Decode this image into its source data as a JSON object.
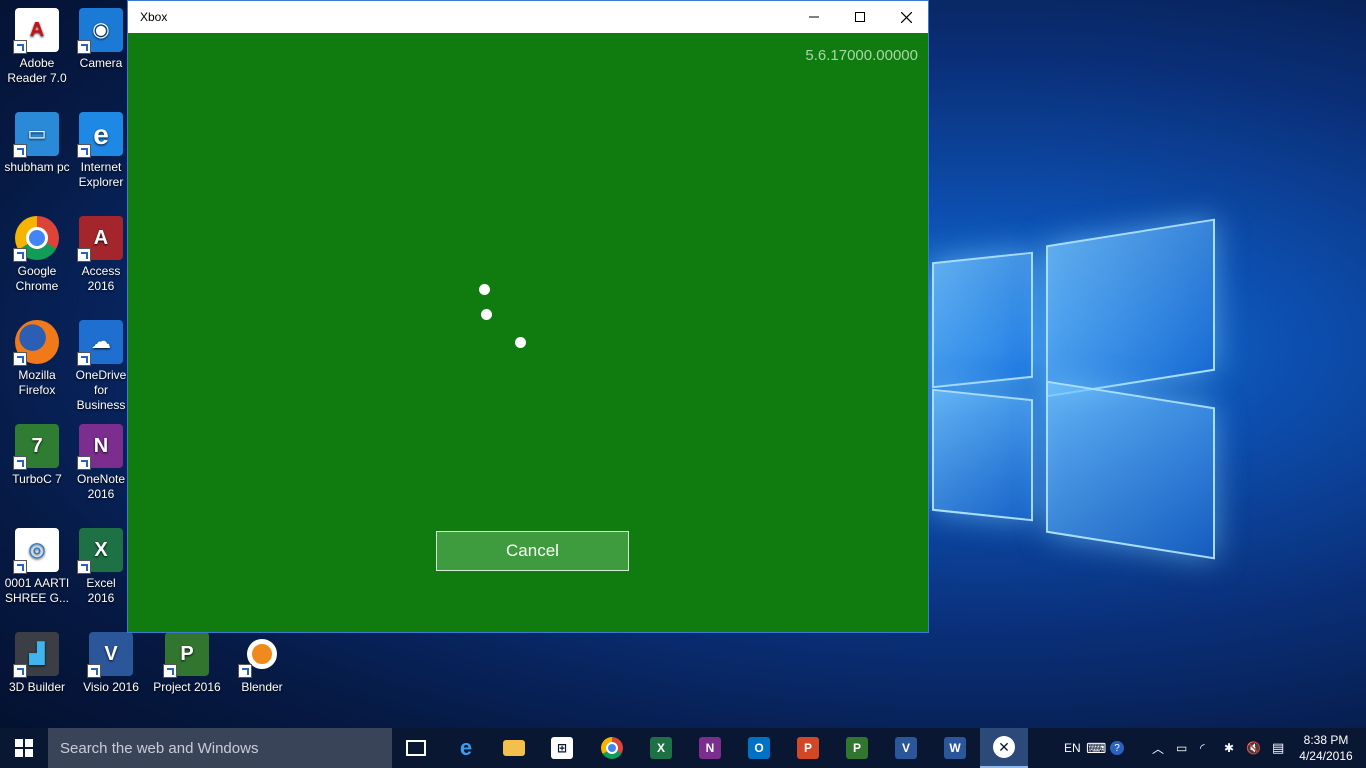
{
  "window": {
    "title": "Xbox",
    "version": "5.6.17000.00000",
    "cancel_label": "Cancel",
    "accent": "#107c10"
  },
  "desktop_icons": [
    {
      "label": "Adobe Reader 7.0",
      "icon": "adobe-reader-icon"
    },
    {
      "label": "Camera",
      "icon": "camera-icon"
    },
    {
      "label": "shubham pc",
      "icon": "computer-icon"
    },
    {
      "label": "Internet Explorer",
      "icon": "internet-explorer-icon"
    },
    {
      "label": "Google Chrome",
      "icon": "chrome-icon"
    },
    {
      "label": "Access 2016",
      "icon": "access-icon"
    },
    {
      "label": "Mozilla Firefox",
      "icon": "firefox-icon"
    },
    {
      "label": "OneDrive for Business",
      "icon": "onedrive-icon"
    },
    {
      "label": "TurboC 7",
      "icon": "turboc-icon"
    },
    {
      "label": "OneNote 2016",
      "icon": "onenote-icon"
    },
    {
      "label": "0001 AARTI SHREE G...",
      "icon": "document-icon"
    },
    {
      "label": "Excel 2016",
      "icon": "excel-icon"
    },
    {
      "label": "3D Builder",
      "icon": "3d-builder-icon"
    },
    {
      "label": "Visio 2016",
      "icon": "visio-icon"
    },
    {
      "label": "Project 2016",
      "icon": "project-icon"
    },
    {
      "label": "Blender",
      "icon": "blender-icon"
    }
  ],
  "taskbar": {
    "search_placeholder": "Search the web and Windows",
    "apps": [
      "task-view-icon",
      "edge-icon",
      "file-explorer-icon",
      "store-icon",
      "chrome-icon",
      "excel-icon",
      "onenote-icon",
      "outlook-icon",
      "powerpoint-icon",
      "project-icon",
      "visio-icon",
      "word-icon",
      "xbox-icon"
    ],
    "language": "EN",
    "time": "8:38 PM",
    "date": "4/24/2016"
  }
}
